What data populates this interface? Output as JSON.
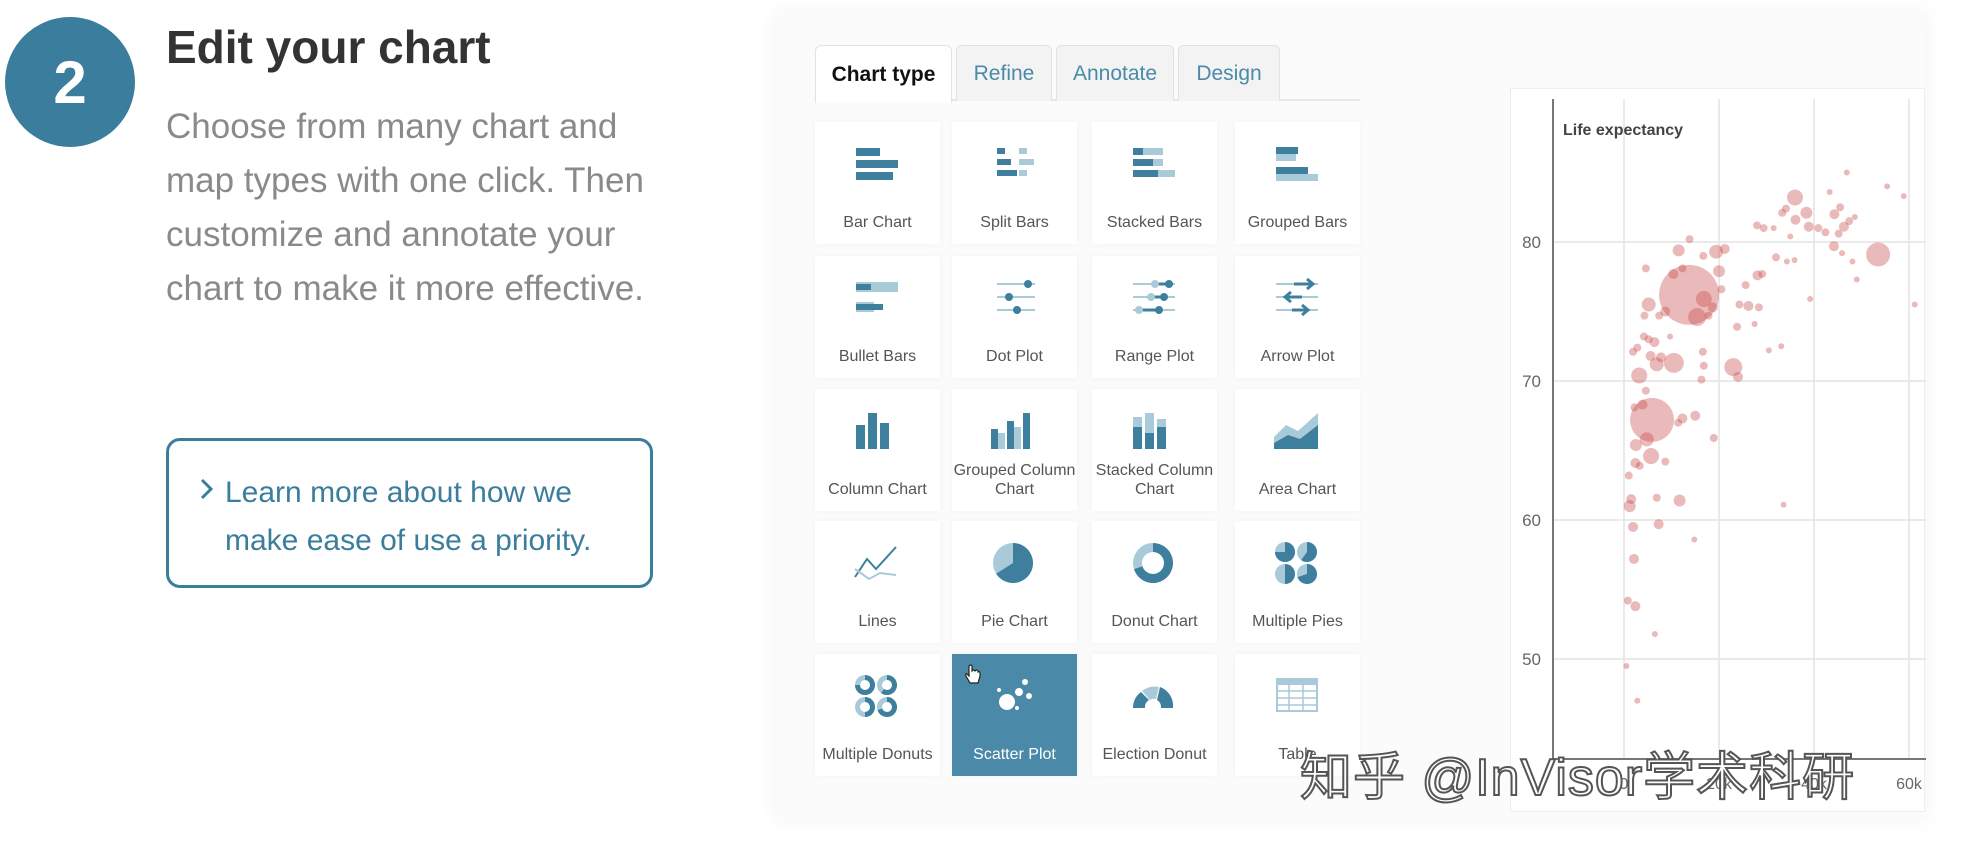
{
  "step": {
    "number": "2",
    "title": "Edit your chart",
    "description": "Choose from many chart and map types with one click. Then customize and annotate your chart to make it more effective."
  },
  "learn_more": {
    "icon": "chevron-right-icon",
    "label": "Learn more about how we make ease of use a priority."
  },
  "tabs": [
    {
      "label": "Chart type",
      "active": true
    },
    {
      "label": "Refine"
    },
    {
      "label": "Annotate"
    },
    {
      "label": "Design"
    }
  ],
  "chart_types": [
    {
      "label": "Bar Chart",
      "icon": "bar"
    },
    {
      "label": "Split Bars",
      "icon": "split"
    },
    {
      "label": "Stacked Bars",
      "icon": "stacked"
    },
    {
      "label": "Grouped Bars",
      "icon": "grouped"
    },
    {
      "label": "Bullet Bars",
      "icon": "bullet"
    },
    {
      "label": "Dot Plot",
      "icon": "dot"
    },
    {
      "label": "Range Plot",
      "icon": "range"
    },
    {
      "label": "Arrow Plot",
      "icon": "arrow"
    },
    {
      "label": "Column Chart",
      "icon": "column"
    },
    {
      "label": "Grouped Column Chart",
      "icon": "gcolumn"
    },
    {
      "label": "Stacked Column Chart",
      "icon": "scolumn"
    },
    {
      "label": "Area Chart",
      "icon": "area"
    },
    {
      "label": "Lines",
      "icon": "lines"
    },
    {
      "label": "Pie Chart",
      "icon": "pie"
    },
    {
      "label": "Donut Chart",
      "icon": "donut"
    },
    {
      "label": "Multiple Pies",
      "icon": "mpies"
    },
    {
      "label": "Multiple Donuts",
      "icon": "mdonuts"
    },
    {
      "label": "Scatter Plot",
      "icon": "scatter",
      "selected": true
    },
    {
      "label": "Election Donut",
      "icon": "election"
    },
    {
      "label": "Table",
      "icon": "table"
    }
  ],
  "colors": {
    "accent": "#3b7d9c",
    "selected": "#4a8aa8",
    "icon_dark": "#3e7f9e",
    "icon_light": "#a9cad8",
    "points": "#c94a4a"
  },
  "watermark": "知乎 @InVisor学术科研",
  "chart_data": {
    "type": "scatter",
    "ylabel": "Life expectancy",
    "ylim": [
      44,
      88
    ],
    "xlim": [
      -15,
      65
    ],
    "yticks": [
      50,
      60,
      70,
      80
    ],
    "xticks": [
      "0",
      "20k",
      "40k",
      "60k"
    ],
    "grid": true,
    "points": [
      [
        13.7,
        76.2,
        30
      ],
      [
        5.9,
        67.2,
        22
      ],
      [
        53.5,
        79.1,
        12
      ],
      [
        36,
        83.2,
        8
      ],
      [
        23,
        71,
        9
      ],
      [
        10.5,
        71.3,
        10
      ],
      [
        3.2,
        70.4,
        8
      ],
      [
        15.4,
        74.6,
        9
      ],
      [
        5.7,
        64.6,
        8
      ],
      [
        16.8,
        75.9,
        8
      ],
      [
        4.8,
        65.8,
        7
      ],
      [
        2.5,
        65.4,
        6
      ],
      [
        1.2,
        61,
        6
      ],
      [
        1.5,
        61.5,
        5
      ],
      [
        1.9,
        59.5,
        5
      ],
      [
        2.1,
        57.2,
        5
      ],
      [
        0.8,
        54.2,
        4
      ],
      [
        2.4,
        53.8,
        5
      ],
      [
        0.5,
        49.5,
        3
      ],
      [
        2.8,
        47,
        3
      ],
      [
        6.5,
        51.8,
        3
      ],
      [
        7.3,
        59.7,
        5
      ],
      [
        11.7,
        61.4,
        6
      ],
      [
        6.9,
        61.6,
        4
      ],
      [
        8.7,
        64.2,
        4
      ],
      [
        14.8,
        58.6,
        3
      ],
      [
        33.6,
        61.1,
        3
      ],
      [
        18.9,
        65.9,
        4
      ],
      [
        15,
        67.5,
        5
      ],
      [
        11.4,
        67,
        4
      ],
      [
        1,
        63.2,
        4
      ],
      [
        2.4,
        64.1,
        5
      ],
      [
        3.3,
        63.9,
        4
      ],
      [
        2.2,
        68.1,
        4
      ],
      [
        3.9,
        68.3,
        5
      ],
      [
        4.6,
        69.3,
        4
      ],
      [
        1.9,
        72.1,
        4
      ],
      [
        2.8,
        72.4,
        4
      ],
      [
        4.2,
        73.2,
        4
      ],
      [
        5.2,
        73,
        4
      ],
      [
        6.4,
        72.8,
        5
      ],
      [
        5.6,
        71.8,
        5
      ],
      [
        7.8,
        71.7,
        5
      ],
      [
        6.9,
        71.2,
        7
      ],
      [
        9.7,
        73.2,
        3
      ],
      [
        8.7,
        75,
        5
      ],
      [
        7.4,
        74.7,
        4
      ],
      [
        5.2,
        75.5,
        7
      ],
      [
        4.3,
        74.7,
        4
      ],
      [
        4.6,
        78.1,
        4
      ],
      [
        10.4,
        77.7,
        5
      ],
      [
        12.3,
        78.1,
        4
      ],
      [
        11.5,
        79.4,
        6
      ],
      [
        13.8,
        80.2,
        4
      ],
      [
        16.7,
        79,
        4
      ],
      [
        19.4,
        79.3,
        7
      ],
      [
        21.2,
        79.5,
        5
      ],
      [
        20,
        77.9,
        6
      ],
      [
        20.5,
        76.6,
        4
      ],
      [
        18.7,
        75.3,
        5
      ],
      [
        17.8,
        74.7,
        4
      ],
      [
        16.6,
        72.1,
        4
      ],
      [
        16.8,
        71.1,
        4
      ],
      [
        16.3,
        70.1,
        4
      ],
      [
        12.3,
        67.3,
        5
      ],
      [
        24,
        70.3,
        5
      ],
      [
        23.8,
        73.9,
        4
      ],
      [
        24.3,
        75.5,
        4
      ],
      [
        26.2,
        75.4,
        5
      ],
      [
        28.4,
        75.3,
        4
      ],
      [
        27.5,
        74.1,
        3
      ],
      [
        30.5,
        72.2,
        3
      ],
      [
        33.1,
        72.5,
        3
      ],
      [
        25.6,
        76.9,
        4
      ],
      [
        28.1,
        77.6,
        5
      ],
      [
        29.1,
        77.7,
        4
      ],
      [
        32,
        78.9,
        4
      ],
      [
        34.3,
        78.6,
        3
      ],
      [
        39.2,
        75.9,
        3
      ],
      [
        28,
        81.2,
        4
      ],
      [
        29.4,
        81,
        4
      ],
      [
        31.5,
        81,
        3
      ],
      [
        33.3,
        82.1,
        4
      ],
      [
        34.1,
        82.4,
        4
      ],
      [
        36.1,
        81.6,
        5
      ],
      [
        38.4,
        82.1,
        6
      ],
      [
        38.9,
        81.1,
        5
      ],
      [
        40.9,
        81,
        4
      ],
      [
        42.4,
        80.7,
        4
      ],
      [
        43.3,
        83.6,
        3
      ],
      [
        44.3,
        82,
        5
      ],
      [
        45.5,
        82.5,
        4
      ],
      [
        45.2,
        80.6,
        4
      ],
      [
        46.3,
        81.1,
        5
      ],
      [
        47.4,
        81.5,
        4
      ],
      [
        48.6,
        81.8,
        3
      ],
      [
        44.2,
        79.7,
        5
      ],
      [
        45.9,
        79.2,
        3
      ],
      [
        48.1,
        78.6,
        3
      ],
      [
        49,
        77.3,
        3
      ],
      [
        46.9,
        85,
        3
      ],
      [
        55.4,
        84,
        3
      ],
      [
        58.9,
        83.3,
        3
      ],
      [
        61.2,
        75.5,
        3
      ],
      [
        64.3,
        82.3,
        3
      ],
      [
        35.9,
        78.7,
        3
      ],
      [
        35,
        80.4,
        3
      ]
    ]
  }
}
